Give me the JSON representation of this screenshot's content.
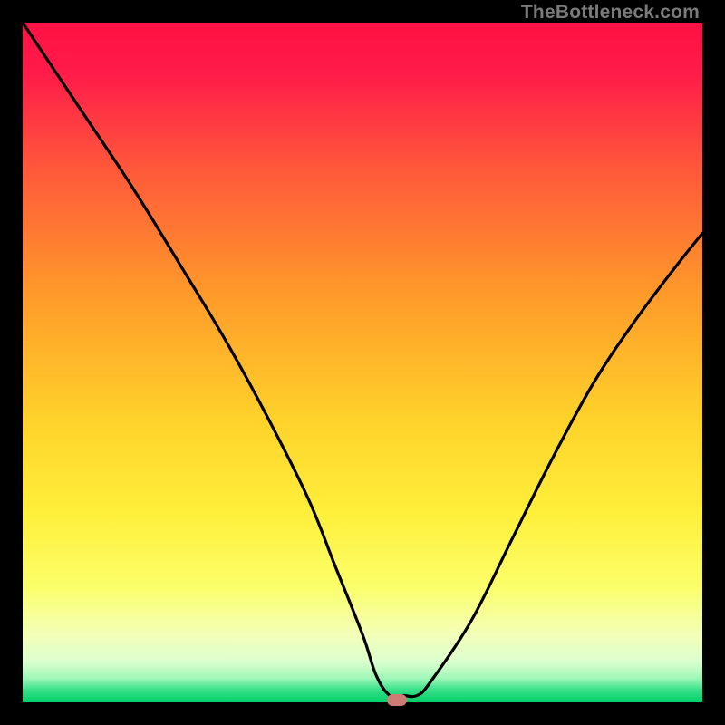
{
  "watermark": "TheBottleneck.com",
  "chart_data": {
    "type": "line",
    "title": "",
    "xlabel": "",
    "ylabel": "",
    "xlim": [
      0,
      100
    ],
    "ylim": [
      0,
      100
    ],
    "grid": false,
    "series": [
      {
        "name": "curve",
        "x": [
          0,
          8,
          16,
          24,
          30,
          36,
          42,
          46,
          50,
          52,
          54,
          56,
          58,
          60,
          66,
          72,
          78,
          84,
          90,
          96,
          100
        ],
        "y": [
          100,
          88,
          76,
          63,
          53,
          42,
          30,
          20,
          10,
          4,
          1,
          1,
          1,
          3,
          12,
          24,
          36,
          47,
          56,
          64,
          69
        ]
      }
    ],
    "marker": {
      "x": 55,
      "y": 0,
      "color": "#cf7b76"
    }
  },
  "colors": {
    "gradient_top": "#ff1a4a",
    "gradient_mid_upper": "#ff8b2a",
    "gradient_mid": "#ffe93a",
    "gradient_lower": "#f3ffb0",
    "gradient_green": "#00d26a",
    "curve": "#000000",
    "background": "#000000"
  }
}
